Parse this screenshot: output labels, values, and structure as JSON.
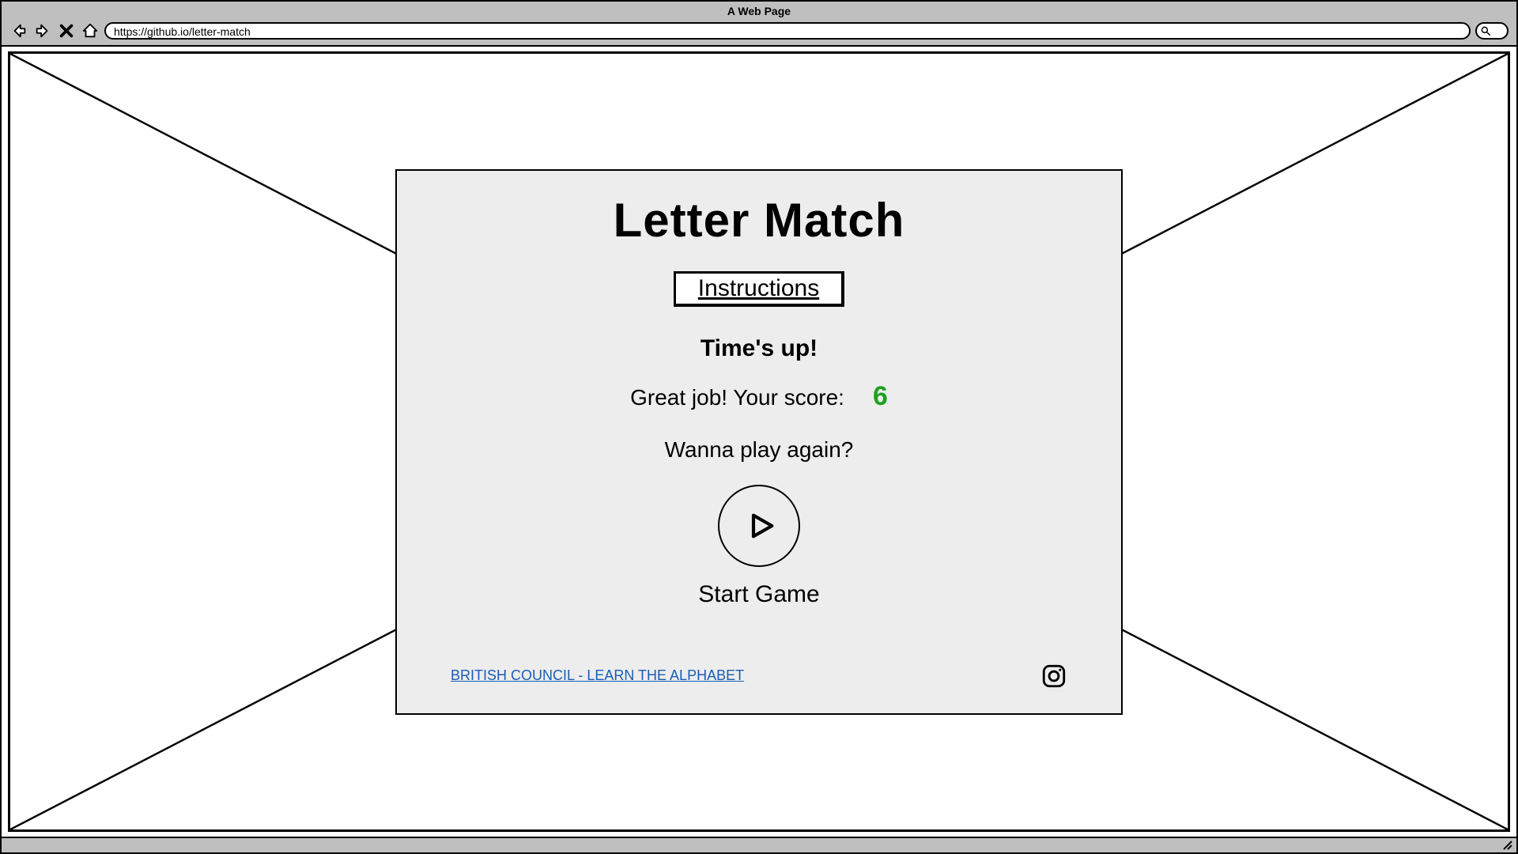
{
  "browser": {
    "title": "A Web Page",
    "url": "https://github.io/letter-match"
  },
  "game": {
    "title": "Letter Match",
    "instructions_label": "Instructions",
    "times_up": "Time's up!",
    "score_label": "Great job! Your score:",
    "score_value": "6",
    "play_again": "Wanna play again?",
    "start_label": "Start Game"
  },
  "footer": {
    "alphabet_link": "BRITISH COUNCIL - LEARN THE ALPHABET"
  }
}
